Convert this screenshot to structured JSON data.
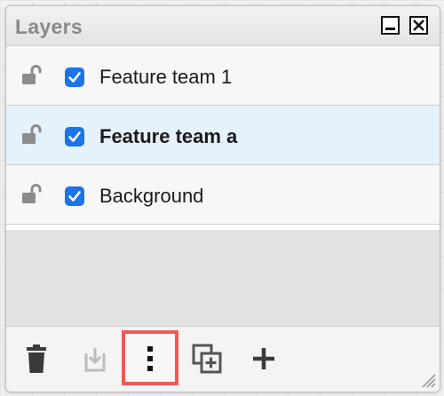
{
  "window": {
    "title": "Layers",
    "minimize_icon": "minimize-icon",
    "close_icon": "close-icon"
  },
  "layers": [
    {
      "name": "Feature team 1",
      "checked": true,
      "selected": false,
      "lock_icon": "unlocked-icon"
    },
    {
      "name": "Feature team a",
      "checked": true,
      "selected": true,
      "lock_icon": "unlocked-icon"
    },
    {
      "name": "Background",
      "checked": true,
      "selected": false,
      "lock_icon": "unlocked-icon"
    }
  ],
  "toolbar": {
    "buttons": [
      {
        "id": "delete",
        "icon": "trash-icon"
      },
      {
        "id": "move",
        "icon": "move-to-layer-icon"
      },
      {
        "id": "more",
        "icon": "vertical-ellipsis-icon",
        "highlighted": true
      },
      {
        "id": "duplicate",
        "icon": "duplicate-icon"
      },
      {
        "id": "add",
        "icon": "plus-icon"
      }
    ]
  },
  "colors": {
    "checkbox": "#1b74e8",
    "selected_row": "#e5f1fb",
    "highlight_border": "#ef5a55",
    "icon_gray": "#8c8c8c",
    "icon_dark": "#3a3a3a"
  }
}
